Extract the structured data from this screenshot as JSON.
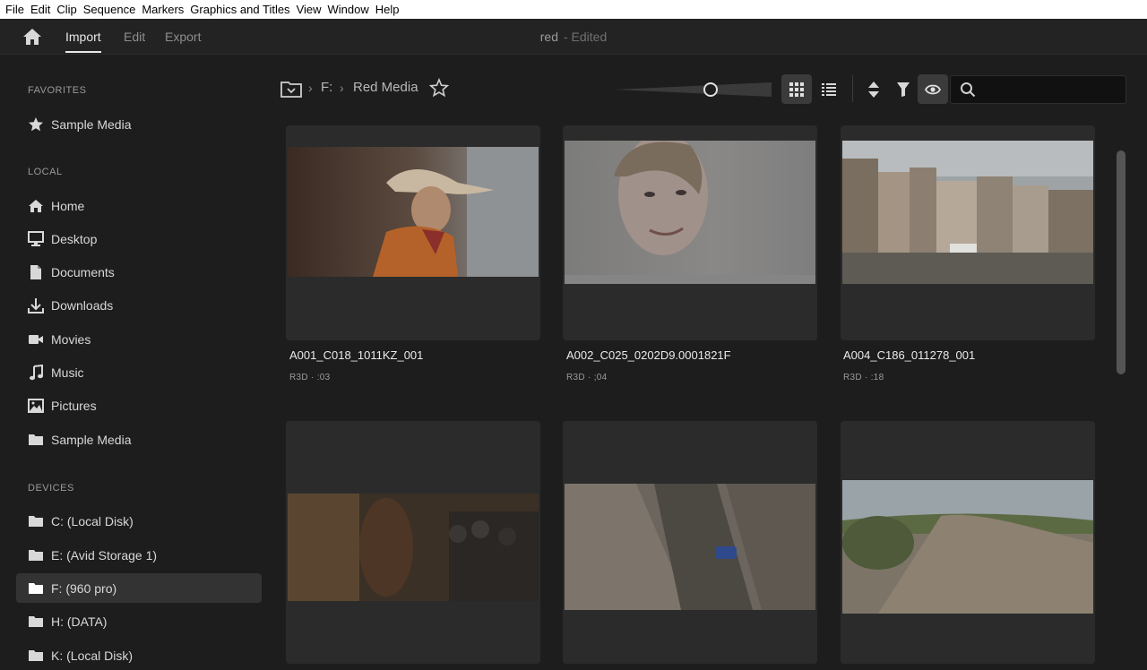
{
  "menu": [
    "File",
    "Edit",
    "Clip",
    "Sequence",
    "Markers",
    "Graphics and Titles",
    "View",
    "Window",
    "Help"
  ],
  "header": {
    "tabs": [
      "Import",
      "Edit",
      "Export"
    ],
    "active_tab": "Import",
    "project_name": "red",
    "project_status": "- Edited"
  },
  "sidebar": {
    "favorites_label": "FAVORITES",
    "favorites": [
      {
        "label": "Sample Media",
        "icon": "star-icon"
      }
    ],
    "local_label": "LOCAL",
    "local": [
      {
        "label": "Home",
        "icon": "home-icon"
      },
      {
        "label": "Desktop",
        "icon": "desktop-icon"
      },
      {
        "label": "Documents",
        "icon": "document-icon"
      },
      {
        "label": "Downloads",
        "icon": "download-icon"
      },
      {
        "label": "Movies",
        "icon": "video-camera-icon"
      },
      {
        "label": "Music",
        "icon": "music-note-icon"
      },
      {
        "label": "Pictures",
        "icon": "image-icon"
      },
      {
        "label": "Sample Media",
        "icon": "folder-icon"
      }
    ],
    "devices_label": "DEVICES",
    "devices": [
      {
        "label": "C: (Local Disk)",
        "icon": "folder-icon"
      },
      {
        "label": "E: (Avid Storage 1)",
        "icon": "folder-icon"
      },
      {
        "label": "F: (960 pro)",
        "icon": "folder-icon",
        "selected": true
      },
      {
        "label": "H: (DATA)",
        "icon": "folder-icon"
      },
      {
        "label": "K: (Local Disk)",
        "icon": "folder-icon"
      }
    ]
  },
  "breadcrumb": {
    "root_icon": "folder-dropdown-icon",
    "items": [
      "F:",
      "Red Media"
    ],
    "favorite_icon": "star-outline-icon"
  },
  "toolbar": {
    "zoom_level": 0.62,
    "grid_view_icon": "grid-view-icon",
    "list_view_icon": "list-view-icon",
    "sort_icon": "sort-icon",
    "filter_icon": "filter-icon",
    "preview_icon": "eye-icon",
    "search_icon": "search-icon",
    "search_placeholder": "",
    "search_value": ""
  },
  "clips": [
    {
      "name": "A001_C018_1011KZ_001",
      "format": "R3D",
      "duration": ":03",
      "scene": "cowboy-in-stable"
    },
    {
      "name": "A002_C025_0202D9.0001821F",
      "format": "R3D",
      "duration": ";04",
      "scene": "woman-portrait"
    },
    {
      "name": "A004_C186_011278_001",
      "format": "R3D",
      "duration": ":18",
      "scene": "venice-canal"
    },
    {
      "name": "",
      "format": "",
      "duration": "",
      "scene": "night-street-crowd"
    },
    {
      "name": "",
      "format": "",
      "duration": "",
      "scene": "rally-car-canyon"
    },
    {
      "name": "",
      "format": "",
      "duration": "",
      "scene": "dirt-track-field"
    }
  ],
  "colors": {
    "background": "#1d1d1d",
    "card": "#2b2b2b",
    "selected": "#333333",
    "text": "#d8d8d8",
    "menubar": "#ffffff"
  }
}
